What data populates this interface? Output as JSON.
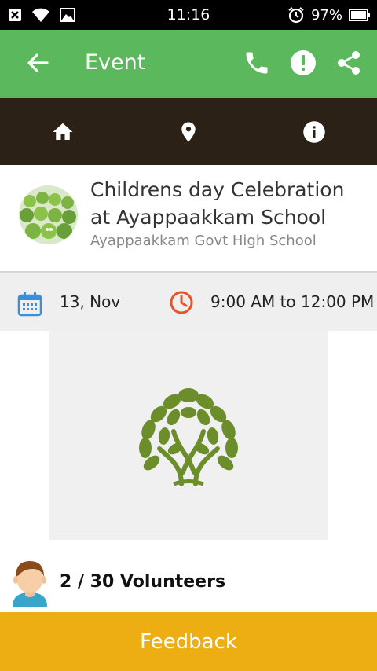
{
  "status_bar": {
    "time": "11:16",
    "battery": "97%"
  },
  "app_bar": {
    "title": "Event"
  },
  "event": {
    "title": "Childrens day Celebration at Ayappaakkam School",
    "venue": "Ayappaakkam Govt High School",
    "date": "13, Nov",
    "time": "9:00 AM to 12:00 PM"
  },
  "volunteers": {
    "label": "2 / 30 Volunteers"
  },
  "footer": {
    "feedback_label": "Feedback"
  },
  "colors": {
    "app_bar": "#5cb85c",
    "tab_bar": "#2b2117",
    "feedback": "#ecae12",
    "calendar_icon": "#3a8fd8",
    "clock_icon": "#e8532a",
    "tree_logo": "#6b8e2b"
  },
  "icons": [
    "close-icon",
    "wifi-icon",
    "image-icon",
    "alarm-icon",
    "battery-icon",
    "back-arrow-icon",
    "phone-icon",
    "alert-icon",
    "share-icon",
    "home-icon",
    "location-pin-icon",
    "info-icon",
    "calendar-icon",
    "clock-icon",
    "tree-logo",
    "volunteer-avatar-icon"
  ]
}
